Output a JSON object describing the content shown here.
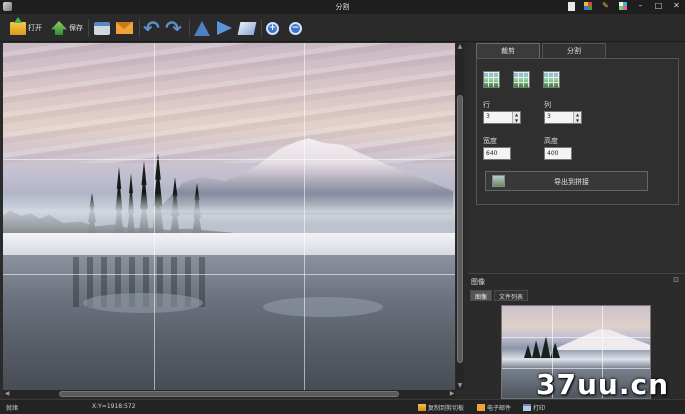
{
  "window": {
    "title": "分割",
    "app_icon": "app-logo-icon",
    "title_icons": [
      "document-icon",
      "grid-color-icon",
      "pen-icon",
      "palette-icon"
    ],
    "controls": [
      "minimize",
      "maximize",
      "close"
    ],
    "control_glyphs": {
      "minimize": "–",
      "maximize": "□",
      "close": "✕"
    }
  },
  "toolbar": {
    "open_label": "打开",
    "save_label": "保存",
    "icons": [
      "open-folder-icon",
      "save-icon",
      "print-icon",
      "email-icon",
      "undo-icon",
      "redo-icon",
      "flip-vertical-icon",
      "flip-horizontal-icon",
      "rotate-icon",
      "zoom-in-icon",
      "zoom-out-icon"
    ]
  },
  "panel": {
    "tabs": [
      {
        "label": "裁剪",
        "active": true
      },
      {
        "label": "分割",
        "active": false
      }
    ],
    "grid_presets": [
      "grid-preset-1-icon",
      "grid-preset-2-icon",
      "grid-preset-3-icon"
    ],
    "rows_label": "行",
    "rows_value": "3",
    "cols_label": "列",
    "cols_value": "3",
    "width_label": "宽度",
    "width_value": "640",
    "height_label": "高度",
    "height_value": "400",
    "export_label": "导出到拼接"
  },
  "image_panel": {
    "title": "图像",
    "pin": "⊡",
    "subtabs": [
      {
        "label": "图像",
        "active": true
      },
      {
        "label": "文件列表",
        "active": false
      }
    ]
  },
  "grid": {
    "rows": 3,
    "cols": 3
  },
  "status": {
    "ready": "就绪",
    "coords": "X:Y=1918:572",
    "copy_label": "复制到剪切板",
    "mail_label": "电子邮件",
    "print_label": "打印"
  },
  "watermark": "37uu.cn",
  "colors": {
    "background": "#2b2b2b",
    "titlebar": "#1e1e1e",
    "accent_blue": "#4f7fc0"
  }
}
